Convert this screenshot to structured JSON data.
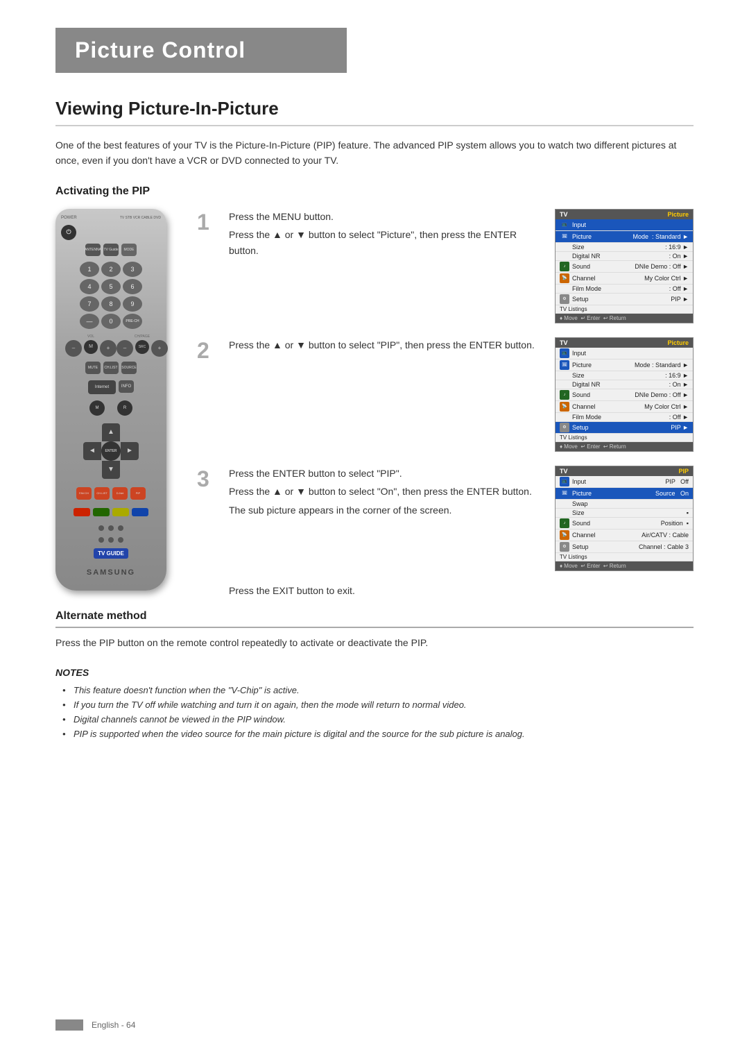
{
  "header": {
    "title": "Picture Control",
    "bg_color": "#888888"
  },
  "section": {
    "title": "Viewing Picture-In-Picture",
    "intro": "One of the best features of your TV is the Picture-In-Picture (PIP) feature. The advanced PIP system allows you to watch two different pictures at once, even if you don't have a VCR or DVD connected to your TV."
  },
  "subsection": {
    "title": "Activating the PIP"
  },
  "steps": [
    {
      "number": "1",
      "text_lines": [
        "Press the MENU button.",
        "Press the ▲ or ▼ button to select \"Picture\", then press the ENTER button."
      ],
      "screen": {
        "tv_label": "TV",
        "title": "Picture",
        "rows": [
          {
            "icon": "input",
            "key": "Input",
            "value": "",
            "arrow": "►",
            "highlight": false
          },
          {
            "icon": "picture",
            "key": "Picture",
            "value": "Mode",
            "value2": ": Standard",
            "arrow": "►",
            "highlight": true
          },
          {
            "icon": "picture",
            "key": "",
            "value": "Size",
            "value2": ": 16:9",
            "arrow": "►",
            "highlight": false
          },
          {
            "icon": "picture",
            "key": "",
            "value": "Digital NR",
            "value2": ": On",
            "arrow": "►",
            "highlight": false
          },
          {
            "icon": "sound",
            "key": "Sound",
            "value": "DNIe Demo",
            "value2": ": Off",
            "arrow": "►",
            "highlight": false
          },
          {
            "icon": "channel",
            "key": "Channel",
            "value": "My Color Control",
            "value2": "",
            "arrow": "►",
            "highlight": false
          },
          {
            "icon": "channel",
            "key": "",
            "value": "Film Mode",
            "value2": ": Off",
            "arrow": "►",
            "highlight": false
          },
          {
            "icon": "setup",
            "key": "Setup",
            "value": "PIP",
            "value2": "",
            "arrow": "►",
            "highlight": false
          }
        ],
        "footer": "♦ Move   ↵ Enter   ↩ Return"
      }
    },
    {
      "number": "2",
      "text_lines": [
        "Press the ▲ or ▼ button to select \"PIP\", then press the ENTER button."
      ],
      "screen": {
        "tv_label": "TV",
        "title": "Picture",
        "rows": [
          {
            "icon": "input",
            "key": "Input",
            "value": "",
            "arrow": "►",
            "highlight": false
          },
          {
            "icon": "picture",
            "key": "Picture",
            "value": "Mode",
            "value2": ": Standard",
            "arrow": "►",
            "highlight": false
          },
          {
            "icon": "picture",
            "key": "",
            "value": "Size",
            "value2": ": 16:9",
            "arrow": "►",
            "highlight": false
          },
          {
            "icon": "picture",
            "key": "",
            "value": "Digital NR",
            "value2": ": On",
            "arrow": "►",
            "highlight": false
          },
          {
            "icon": "sound",
            "key": "Sound",
            "value": "DNIe Demo",
            "value2": ": Off",
            "arrow": "►",
            "highlight": false
          },
          {
            "icon": "channel",
            "key": "Channel",
            "value": "My Color Control",
            "value2": "",
            "arrow": "►",
            "highlight": false
          },
          {
            "icon": "channel",
            "key": "",
            "value": "Film Mode",
            "value2": ": Off",
            "arrow": "►",
            "highlight": false
          },
          {
            "icon": "setup",
            "key": "Setup",
            "value": "PIP",
            "value2": "",
            "arrow": "►",
            "highlight": true
          }
        ],
        "footer": "♦ Move   ↵ Enter   ↩ Return"
      }
    },
    {
      "number": "3",
      "text_lines": [
        "Press the ENTER button to select \"PIP\".",
        "Press the ▲ or ▼ button to select \"On\", then press the ENTER button.",
        "The sub picture appears in the corner of the screen."
      ],
      "screen": {
        "tv_label": "TV",
        "title": "PIP",
        "rows": [
          {
            "icon": "input",
            "key": "Input",
            "value": "PIP",
            "value2": "Off",
            "arrow": "",
            "highlight": false
          },
          {
            "icon": "picture",
            "key": "Picture",
            "value": "Source",
            "value2": "On",
            "arrow": "",
            "highlight": true
          },
          {
            "icon": "picture",
            "key": "",
            "value": "Swap",
            "value2": "",
            "arrow": "",
            "highlight": false
          },
          {
            "icon": "picture",
            "key": "",
            "value": "Size",
            "value2": "▪",
            "arrow": "",
            "highlight": false
          },
          {
            "icon": "sound",
            "key": "Sound",
            "value": "Position",
            "value2": "▪",
            "arrow": "",
            "highlight": false
          },
          {
            "icon": "channel",
            "key": "Channel",
            "value": "Air/CATV",
            "value2": ": Cable",
            "arrow": "",
            "highlight": false
          },
          {
            "icon": "setup",
            "key": "Setup",
            "value": "Channel",
            "value2": ": Cable 3",
            "arrow": "",
            "highlight": false
          }
        ],
        "footer": "♦ Move   ↵ Enter   ↩ Return"
      }
    }
  ],
  "exit_text": "Press the EXIT button to exit.",
  "alternate_method": {
    "title": "Alternate method",
    "text": "Press the PIP button on the remote control repeatedly to activate or deactivate the PIP."
  },
  "notes": {
    "title": "NOTES",
    "items": [
      "This feature doesn't function when the \"V-Chip\" is active.",
      "If you turn the TV off while watching and turn it on again, then the mode will return to normal video.",
      "Digital channels cannot be viewed in the PIP window.",
      "PIP is supported when the video source for the main picture is digital and the source for the sub picture is analog."
    ]
  },
  "footer": {
    "text": "English - 64"
  },
  "remote": {
    "samsung_label": "SAMSUNG",
    "tv_guide_label": "TV GUIDE",
    "power_label": "POWER",
    "enter_label": "ENTER"
  }
}
